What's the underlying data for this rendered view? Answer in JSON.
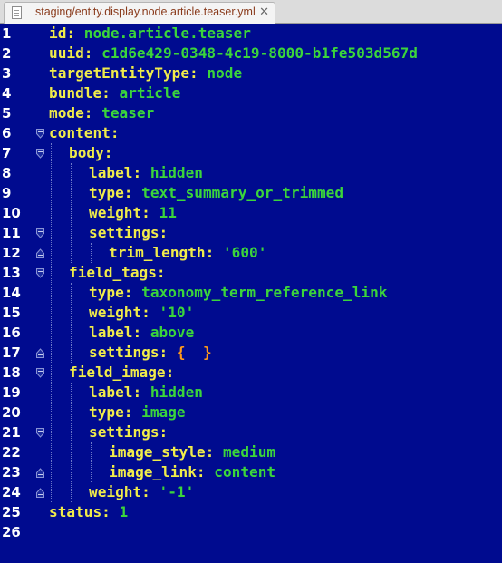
{
  "tab": {
    "title": "staging/entity.display.node.article.teaser.yml",
    "close_glyph": "✕",
    "icon": "document-icon"
  },
  "colors": {
    "background": "#000b8f",
    "key": "#f0ec4a",
    "value": "#3bd53b",
    "brace": "#ff9a1a",
    "line_number": "#ffffff"
  },
  "lines": [
    {
      "num": "1",
      "indent": 0,
      "key": "id:",
      "value": "node.article.teaser",
      "fold": ""
    },
    {
      "num": "2",
      "indent": 0,
      "key": "uuid:",
      "value": "c1d6e429-0348-4c19-8000-b1fe503d567d",
      "fold": ""
    },
    {
      "num": "3",
      "indent": 0,
      "key": "targetEntityType:",
      "value": "node",
      "fold": ""
    },
    {
      "num": "4",
      "indent": 0,
      "key": "bundle:",
      "value": "article",
      "fold": ""
    },
    {
      "num": "5",
      "indent": 0,
      "key": "mode:",
      "value": "teaser",
      "fold": ""
    },
    {
      "num": "6",
      "indent": 0,
      "key": "content:",
      "value": "",
      "fold": "start"
    },
    {
      "num": "7",
      "indent": 1,
      "key": "body:",
      "value": "",
      "fold": "start"
    },
    {
      "num": "8",
      "indent": 2,
      "key": "label:",
      "value": "hidden",
      "fold": ""
    },
    {
      "num": "9",
      "indent": 2,
      "key": "type:",
      "value": "text_summary_or_trimmed",
      "fold": ""
    },
    {
      "num": "10",
      "indent": 2,
      "key": "weight:",
      "value": "11",
      "fold": ""
    },
    {
      "num": "11",
      "indent": 2,
      "key": "settings:",
      "value": "",
      "fold": "start"
    },
    {
      "num": "12",
      "indent": 3,
      "key": "trim_length:",
      "value": "'600'",
      "fold": "end"
    },
    {
      "num": "13",
      "indent": 1,
      "key": "field_tags:",
      "value": "",
      "fold": "start"
    },
    {
      "num": "14",
      "indent": 2,
      "key": "type:",
      "value": "taxonomy_term_reference_link",
      "fold": ""
    },
    {
      "num": "15",
      "indent": 2,
      "key": "weight:",
      "value": "'10'",
      "fold": ""
    },
    {
      "num": "16",
      "indent": 2,
      "key": "label:",
      "value": "above",
      "fold": ""
    },
    {
      "num": "17",
      "indent": 2,
      "key": "settings:",
      "value": "",
      "brace": "{  }",
      "fold": "end"
    },
    {
      "num": "18",
      "indent": 1,
      "key": "field_image:",
      "value": "",
      "fold": "start"
    },
    {
      "num": "19",
      "indent": 2,
      "key": "label:",
      "value": "hidden",
      "fold": ""
    },
    {
      "num": "20",
      "indent": 2,
      "key": "type:",
      "value": "image",
      "fold": ""
    },
    {
      "num": "21",
      "indent": 2,
      "key": "settings:",
      "value": "",
      "fold": "start"
    },
    {
      "num": "22",
      "indent": 3,
      "key": "image_style:",
      "value": "medium",
      "fold": ""
    },
    {
      "num": "23",
      "indent": 3,
      "key": "image_link:",
      "value": "content",
      "fold": "end"
    },
    {
      "num": "24",
      "indent": 2,
      "key": "weight:",
      "value": "'-1'",
      "fold": "end"
    },
    {
      "num": "25",
      "indent": 0,
      "key": "status:",
      "value": "1",
      "fold": ""
    },
    {
      "num": "26",
      "indent": 0,
      "key": "",
      "value": "",
      "fold": ""
    }
  ]
}
